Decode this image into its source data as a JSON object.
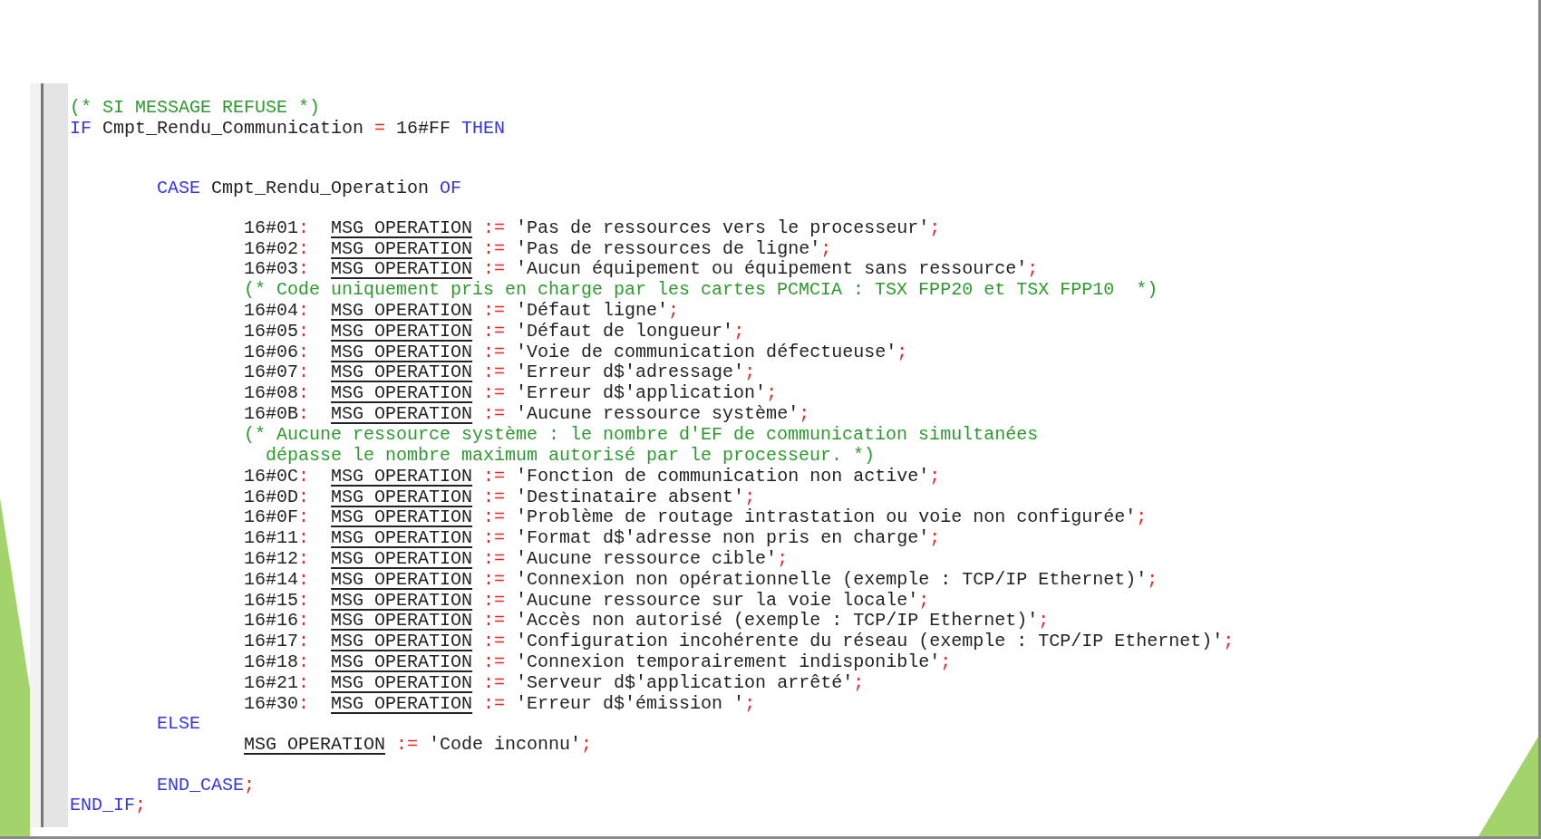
{
  "editor": {
    "lines": [
      {
        "kind": "code",
        "tokens": [
          {
            "kind": "comment",
            "text": "(* SI MESSAGE REFUSE *)"
          }
        ]
      },
      {
        "kind": "code",
        "tokens": [
          {
            "kind": "keyword",
            "text": "IF"
          },
          {
            "kind": "text",
            "text": " Cmpt_Rendu_Communication "
          },
          {
            "kind": "operator",
            "text": "="
          },
          {
            "kind": "text",
            "text": " 16#FF "
          },
          {
            "kind": "keyword",
            "text": "THEN"
          }
        ],
        "children": [
          {
            "kind": "blank"
          },
          {
            "kind": "blank"
          },
          {
            "kind": "code",
            "tokens": [
              {
                "kind": "keyword",
                "text": "CASE"
              },
              {
                "kind": "text",
                "text": " Cmpt_Rendu_Operation "
              },
              {
                "kind": "keyword",
                "text": "OF"
              }
            ],
            "children": [
              {
                "kind": "blank"
              },
              {
                "kind": "code",
                "tokens": [
                  {
                    "kind": "text",
                    "text": "16#01"
                  },
                  {
                    "kind": "operator",
                    "text": ":  "
                  },
                  {
                    "kind": "variable",
                    "text": "MSG OPERATION"
                  },
                  {
                    "kind": "operator",
                    "text": " := "
                  },
                  {
                    "kind": "string",
                    "text": "'Pas de ressources vers le processeur'"
                  },
                  {
                    "kind": "operator",
                    "text": ";"
                  }
                ]
              },
              {
                "kind": "code",
                "tokens": [
                  {
                    "kind": "text",
                    "text": "16#02"
                  },
                  {
                    "kind": "operator",
                    "text": ":  "
                  },
                  {
                    "kind": "variable",
                    "text": "MSG OPERATION"
                  },
                  {
                    "kind": "operator",
                    "text": " := "
                  },
                  {
                    "kind": "string",
                    "text": "'Pas de ressources de ligne'"
                  },
                  {
                    "kind": "operator",
                    "text": ";"
                  }
                ]
              },
              {
                "kind": "code",
                "tokens": [
                  {
                    "kind": "text",
                    "text": "16#03"
                  },
                  {
                    "kind": "operator",
                    "text": ":  "
                  },
                  {
                    "kind": "variable",
                    "text": "MSG OPERATION"
                  },
                  {
                    "kind": "operator",
                    "text": " := "
                  },
                  {
                    "kind": "string",
                    "text": "'Aucun équipement ou équipement sans ressource'"
                  },
                  {
                    "kind": "operator",
                    "text": ";"
                  }
                ]
              },
              {
                "kind": "code",
                "tokens": [
                  {
                    "kind": "comment",
                    "text": "(* Code uniquement pris en charge par les cartes PCMCIA : TSX FPP20 et TSX FPP10  *)"
                  }
                ]
              },
              {
                "kind": "code",
                "tokens": [
                  {
                    "kind": "text",
                    "text": "16#04"
                  },
                  {
                    "kind": "operator",
                    "text": ":  "
                  },
                  {
                    "kind": "variable",
                    "text": "MSG OPERATION"
                  },
                  {
                    "kind": "operator",
                    "text": " := "
                  },
                  {
                    "kind": "string",
                    "text": "'Défaut ligne'"
                  },
                  {
                    "kind": "operator",
                    "text": ";"
                  }
                ]
              },
              {
                "kind": "code",
                "tokens": [
                  {
                    "kind": "text",
                    "text": "16#05"
                  },
                  {
                    "kind": "operator",
                    "text": ":  "
                  },
                  {
                    "kind": "variable",
                    "text": "MSG OPERATION"
                  },
                  {
                    "kind": "operator",
                    "text": " := "
                  },
                  {
                    "kind": "string",
                    "text": "'Défaut de longueur'"
                  },
                  {
                    "kind": "operator",
                    "text": ";"
                  }
                ]
              },
              {
                "kind": "code",
                "tokens": [
                  {
                    "kind": "text",
                    "text": "16#06"
                  },
                  {
                    "kind": "operator",
                    "text": ":  "
                  },
                  {
                    "kind": "variable",
                    "text": "MSG OPERATION"
                  },
                  {
                    "kind": "operator",
                    "text": " := "
                  },
                  {
                    "kind": "string",
                    "text": "'Voie de communication défectueuse'"
                  },
                  {
                    "kind": "operator",
                    "text": ";"
                  }
                ]
              },
              {
                "kind": "code",
                "tokens": [
                  {
                    "kind": "text",
                    "text": "16#07"
                  },
                  {
                    "kind": "operator",
                    "text": ":  "
                  },
                  {
                    "kind": "variable",
                    "text": "MSG OPERATION"
                  },
                  {
                    "kind": "operator",
                    "text": " := "
                  },
                  {
                    "kind": "string",
                    "text": "'Erreur d$'adressage'"
                  },
                  {
                    "kind": "operator",
                    "text": ";"
                  }
                ]
              },
              {
                "kind": "code",
                "tokens": [
                  {
                    "kind": "text",
                    "text": "16#08"
                  },
                  {
                    "kind": "operator",
                    "text": ":  "
                  },
                  {
                    "kind": "variable",
                    "text": "MSG OPERATION"
                  },
                  {
                    "kind": "operator",
                    "text": " := "
                  },
                  {
                    "kind": "string",
                    "text": "'Erreur d$'application'"
                  },
                  {
                    "kind": "operator",
                    "text": ";"
                  }
                ]
              },
              {
                "kind": "code",
                "tokens": [
                  {
                    "kind": "text",
                    "text": "16#0B"
                  },
                  {
                    "kind": "operator",
                    "text": ":  "
                  },
                  {
                    "kind": "variable",
                    "text": "MSG OPERATION"
                  },
                  {
                    "kind": "operator",
                    "text": " := "
                  },
                  {
                    "kind": "string",
                    "text": "'Aucune ressource système'"
                  },
                  {
                    "kind": "operator",
                    "text": ";"
                  }
                ]
              },
              {
                "kind": "code",
                "tokens": [
                  {
                    "kind": "comment",
                    "text": "(* Aucune ressource système : le nombre d'EF de communication simultanées\n  dépasse le nombre maximum autorisé par le processeur. *)"
                  }
                ]
              },
              {
                "kind": "code",
                "tokens": [
                  {
                    "kind": "text",
                    "text": "16#0C"
                  },
                  {
                    "kind": "operator",
                    "text": ":  "
                  },
                  {
                    "kind": "variable",
                    "text": "MSG OPERATION"
                  },
                  {
                    "kind": "operator",
                    "text": " := "
                  },
                  {
                    "kind": "string",
                    "text": "'Fonction de communication non active'"
                  },
                  {
                    "kind": "operator",
                    "text": ";"
                  }
                ]
              },
              {
                "kind": "code",
                "tokens": [
                  {
                    "kind": "text",
                    "text": "16#0D"
                  },
                  {
                    "kind": "operator",
                    "text": ":  "
                  },
                  {
                    "kind": "variable",
                    "text": "MSG OPERATION"
                  },
                  {
                    "kind": "operator",
                    "text": " := "
                  },
                  {
                    "kind": "string",
                    "text": "'Destinataire absent'"
                  },
                  {
                    "kind": "operator",
                    "text": ";"
                  }
                ]
              },
              {
                "kind": "code",
                "tokens": [
                  {
                    "kind": "text",
                    "text": "16#0F"
                  },
                  {
                    "kind": "operator",
                    "text": ":  "
                  },
                  {
                    "kind": "variable",
                    "text": "MSG OPERATION"
                  },
                  {
                    "kind": "operator",
                    "text": " := "
                  },
                  {
                    "kind": "string",
                    "text": "'Problème de routage intrastation ou voie non configurée'"
                  },
                  {
                    "kind": "operator",
                    "text": ";"
                  }
                ]
              },
              {
                "kind": "code",
                "tokens": [
                  {
                    "kind": "text",
                    "text": "16#11"
                  },
                  {
                    "kind": "operator",
                    "text": ":  "
                  },
                  {
                    "kind": "variable",
                    "text": "MSG OPERATION"
                  },
                  {
                    "kind": "operator",
                    "text": " := "
                  },
                  {
                    "kind": "string",
                    "text": "'Format d$'adresse non pris en charge'"
                  },
                  {
                    "kind": "operator",
                    "text": ";"
                  }
                ]
              },
              {
                "kind": "code",
                "tokens": [
                  {
                    "kind": "text",
                    "text": "16#12"
                  },
                  {
                    "kind": "operator",
                    "text": ":  "
                  },
                  {
                    "kind": "variable",
                    "text": "MSG OPERATION"
                  },
                  {
                    "kind": "operator",
                    "text": " := "
                  },
                  {
                    "kind": "string",
                    "text": "'Aucune ressource cible'"
                  },
                  {
                    "kind": "operator",
                    "text": ";"
                  }
                ]
              },
              {
                "kind": "code",
                "tokens": [
                  {
                    "kind": "text",
                    "text": "16#14"
                  },
                  {
                    "kind": "operator",
                    "text": ":  "
                  },
                  {
                    "kind": "variable",
                    "text": "MSG OPERATION"
                  },
                  {
                    "kind": "operator",
                    "text": " := "
                  },
                  {
                    "kind": "string",
                    "text": "'Connexion non opérationnelle (exemple : TCP/IP Ethernet)'"
                  },
                  {
                    "kind": "operator",
                    "text": ";"
                  }
                ]
              },
              {
                "kind": "code",
                "tokens": [
                  {
                    "kind": "text",
                    "text": "16#15"
                  },
                  {
                    "kind": "operator",
                    "text": ":  "
                  },
                  {
                    "kind": "variable",
                    "text": "MSG OPERATION"
                  },
                  {
                    "kind": "operator",
                    "text": " := "
                  },
                  {
                    "kind": "string",
                    "text": "'Aucune ressource sur la voie locale'"
                  },
                  {
                    "kind": "operator",
                    "text": ";"
                  }
                ]
              },
              {
                "kind": "code",
                "tokens": [
                  {
                    "kind": "text",
                    "text": "16#16"
                  },
                  {
                    "kind": "operator",
                    "text": ":  "
                  },
                  {
                    "kind": "variable",
                    "text": "MSG OPERATION"
                  },
                  {
                    "kind": "operator",
                    "text": " := "
                  },
                  {
                    "kind": "string",
                    "text": "'Accès non autorisé (exemple : TCP/IP Ethernet)'"
                  },
                  {
                    "kind": "operator",
                    "text": ";"
                  }
                ]
              },
              {
                "kind": "code",
                "tokens": [
                  {
                    "kind": "text",
                    "text": "16#17"
                  },
                  {
                    "kind": "operator",
                    "text": ":  "
                  },
                  {
                    "kind": "variable",
                    "text": "MSG OPERATION"
                  },
                  {
                    "kind": "operator",
                    "text": " := "
                  },
                  {
                    "kind": "string",
                    "text": "'Configuration incohérente du réseau (exemple : TCP/IP Ethernet)'"
                  },
                  {
                    "kind": "operator",
                    "text": ";"
                  }
                ]
              },
              {
                "kind": "code",
                "tokens": [
                  {
                    "kind": "text",
                    "text": "16#18"
                  },
                  {
                    "kind": "operator",
                    "text": ":  "
                  },
                  {
                    "kind": "variable",
                    "text": "MSG OPERATION"
                  },
                  {
                    "kind": "operator",
                    "text": " := "
                  },
                  {
                    "kind": "string",
                    "text": "'Connexion temporairement indisponible'"
                  },
                  {
                    "kind": "operator",
                    "text": ";"
                  }
                ]
              },
              {
                "kind": "code",
                "tokens": [
                  {
                    "kind": "text",
                    "text": "16#21"
                  },
                  {
                    "kind": "operator",
                    "text": ":  "
                  },
                  {
                    "kind": "variable",
                    "text": "MSG OPERATION"
                  },
                  {
                    "kind": "operator",
                    "text": " := "
                  },
                  {
                    "kind": "string",
                    "text": "'Serveur d$'application arrêté'"
                  },
                  {
                    "kind": "operator",
                    "text": ";"
                  }
                ]
              },
              {
                "kind": "code",
                "tokens": [
                  {
                    "kind": "text",
                    "text": "16#30"
                  },
                  {
                    "kind": "operator",
                    "text": ":  "
                  },
                  {
                    "kind": "variable",
                    "text": "MSG OPERATION"
                  },
                  {
                    "kind": "operator",
                    "text": " := "
                  },
                  {
                    "kind": "string",
                    "text": "'Erreur d$'émission '"
                  },
                  {
                    "kind": "operator",
                    "text": ";"
                  }
                ]
              }
            ]
          },
          {
            "kind": "code",
            "tokens": [
              {
                "kind": "keyword",
                "text": "ELSE"
              }
            ],
            "children": [
              {
                "kind": "code",
                "tokens": [
                  {
                    "kind": "variable",
                    "text": "MSG OPERATION"
                  },
                  {
                    "kind": "operator",
                    "text": " := "
                  },
                  {
                    "kind": "string",
                    "text": "'Code inconnu'"
                  },
                  {
                    "kind": "operator",
                    "text": ";"
                  }
                ]
              }
            ]
          },
          {
            "kind": "blank"
          },
          {
            "kind": "code",
            "tokens": [
              {
                "kind": "keyword",
                "text": "END_CASE"
              },
              {
                "kind": "operator",
                "text": ";"
              }
            ]
          }
        ]
      },
      {
        "kind": "code",
        "tokens": [
          {
            "kind": "keyword",
            "text": "END_IF"
          },
          {
            "kind": "operator",
            "text": ";"
          }
        ]
      }
    ]
  }
}
